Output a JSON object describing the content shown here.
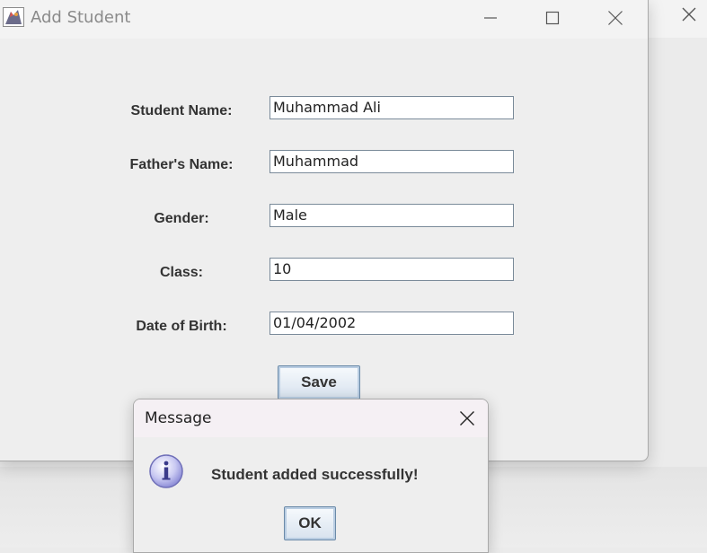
{
  "window": {
    "title": "Add Student",
    "icon": "java-app-icon",
    "controls": [
      "minimize-icon",
      "maximize-icon",
      "close-icon"
    ]
  },
  "background_window": {
    "controls": [
      "close-icon"
    ]
  },
  "form": {
    "fields": [
      {
        "label": "Student Name:",
        "value": "Muhammad Ali"
      },
      {
        "label": "Father's Name:",
        "value": "Muhammad"
      },
      {
        "label": "Gender:",
        "value": "Male"
      },
      {
        "label": "Class:",
        "value": "10"
      },
      {
        "label": "Date of Birth:",
        "value": "01/04/2002"
      }
    ],
    "save_label": "Save"
  },
  "dialog": {
    "title": "Message",
    "message": "Student added successfully!",
    "ok_label": "OK",
    "icon": "info-icon",
    "close_icon": "close-icon"
  },
  "colors": {
    "button_border": "#6b8aa8",
    "info_icon": "#9a9ae0"
  }
}
